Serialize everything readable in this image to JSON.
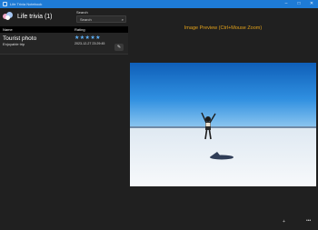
{
  "window": {
    "title": "Life Trivia Notebook",
    "buttons": {
      "minimize": "–",
      "maximize": "□",
      "close": "✕"
    }
  },
  "app": {
    "heading": "Life trivia (1)"
  },
  "search": {
    "label": "Search",
    "placeholder": "Search",
    "icon": "search-icon"
  },
  "table": {
    "columns": [
      "Name",
      "Rating"
    ],
    "rows": [
      {
        "title": "Tourist photo",
        "subtitle": "Enjoyable trip",
        "rating": 5,
        "stars": "★★★★★",
        "date": "2023-12-27 23:29:45",
        "edit_icon": "✎"
      }
    ]
  },
  "preview": {
    "title": "Image Preview (Ctrl+Mouse Zoom)"
  },
  "footer": {
    "zoom_icon": "+",
    "more_icon": "•••"
  },
  "colors": {
    "titlebar": "#1e7bd6",
    "accent_text": "#e3a21a",
    "stars": "#5fb4ff"
  }
}
